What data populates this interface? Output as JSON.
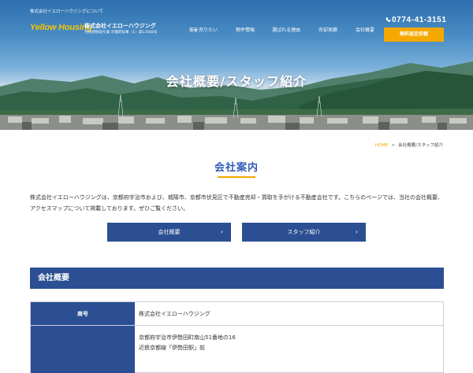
{
  "header": {
    "topline": "株式会社イエローハウジングについて",
    "logo_text": "Yellow Housing",
    "company_name": "株式会社イエローハウジング",
    "license": "宅地建物取引業 京都府知事（1）第13568号",
    "nav": [
      {
        "label": "家を売りたい",
        "has_dropdown": true
      },
      {
        "label": "物件情報"
      },
      {
        "label": "選ばれる理由"
      },
      {
        "label": "売却実績"
      },
      {
        "label": "会社概要"
      }
    ],
    "phone": "0774-41-3151",
    "cta_label": "無料査定依頼"
  },
  "hero": {
    "title": "会社概要/スタッフ紹介"
  },
  "breadcrumb": {
    "home": "HOME",
    "separator": ">",
    "current": "会社概要/スタッフ紹介"
  },
  "section": {
    "title": "会社案内",
    "intro": "株式会社イエローハウジングは、京都府宇治市および、城陽市、京都市伏見区で不動産売却・買取を手がける不動産会社です。こちらのページでは、当社の会社概要、アクセスマップについて掲載しております。ぜひご覧ください。"
  },
  "buttons": [
    {
      "label": "会社概要",
      "chevron": "›"
    },
    {
      "label": "スタッフ紹介",
      "chevron": "›"
    }
  ],
  "overview": {
    "heading": "会社概要",
    "rows": [
      {
        "label": "商号",
        "values": [
          "株式会社イエローハウジング"
        ]
      },
      {
        "label": "",
        "values": [
          "京都府宇治市伊勢田町南山51番地の16",
          "近鉄京都線「伊勢田駅」前"
        ]
      }
    ]
  },
  "colors": {
    "accent": "#f5a800",
    "primary": "#2b4f92",
    "heading": "#2f5bb7",
    "logo": "#f5c400"
  },
  "icons": {
    "phone": "phone-icon",
    "chevron": "chevron-right-icon",
    "dropdown": "caret-down-icon"
  }
}
